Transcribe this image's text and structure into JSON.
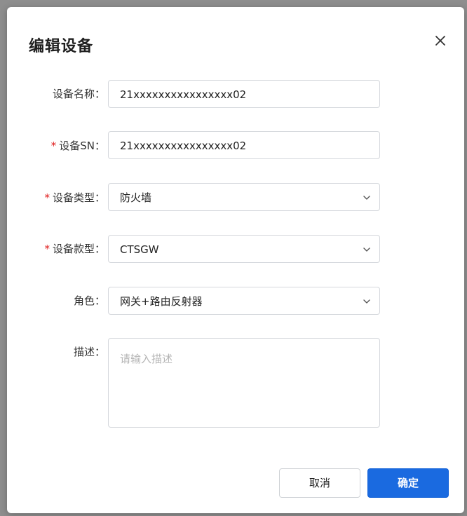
{
  "dialog": {
    "title": "编辑设备",
    "close_icon": "close-icon"
  },
  "form": {
    "name": {
      "label": "设备名称：",
      "required": false,
      "value": "21xxxxxxxxxxxxxxxx02"
    },
    "sn": {
      "label": "设备SN：",
      "required": true,
      "value": "21xxxxxxxxxxxxxxxx02"
    },
    "type": {
      "label": "设备类型：",
      "required": true,
      "value": "防火墙"
    },
    "model": {
      "label": "设备款型：",
      "required": true,
      "value": "CTSGW"
    },
    "role": {
      "label": "角色：",
      "required": false,
      "value": "网关+路由反射器"
    },
    "desc": {
      "label": "描述：",
      "required": false,
      "placeholder": "请输入描述"
    },
    "required_mark": "*"
  },
  "buttons": {
    "cancel": "取消",
    "ok": "确定"
  },
  "colors": {
    "primary": "#1a6ae0",
    "required": "#e02020",
    "border": "#d4d7dc"
  }
}
